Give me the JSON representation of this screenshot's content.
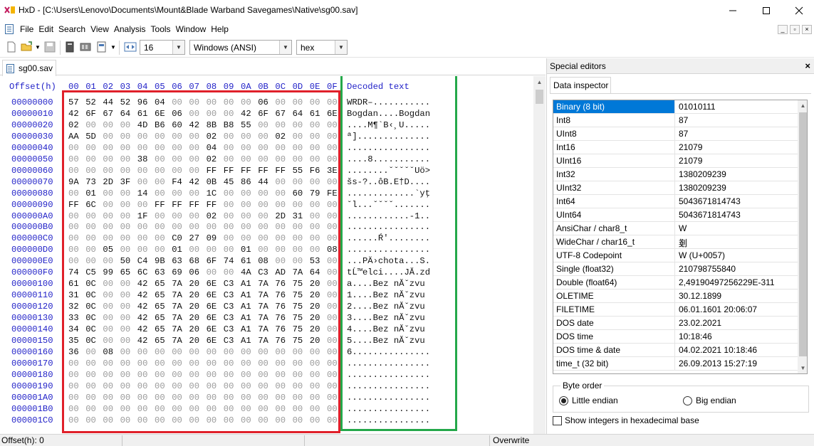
{
  "window": {
    "title": "HxD - [C:\\Users\\Lenovo\\Documents\\Mount&Blade Warband Savegames\\Native\\sg00.sav]"
  },
  "menu": [
    "File",
    "Edit",
    "Search",
    "View",
    "Analysis",
    "Tools",
    "Window",
    "Help"
  ],
  "toolbar": {
    "bytes_per_row": "16",
    "charset": "Windows (ANSI)",
    "offset_base": "hex"
  },
  "document": {
    "tab_label": "sg00.sav"
  },
  "hex": {
    "offset_header": "Offset(h)",
    "columns": [
      "00",
      "01",
      "02",
      "03",
      "04",
      "05",
      "06",
      "07",
      "08",
      "09",
      "0A",
      "0B",
      "0C",
      "0D",
      "0E",
      "0F"
    ],
    "decoded_header": "Decoded text",
    "rows": [
      {
        "offset": "00000000",
        "bytes": [
          "57",
          "52",
          "44",
          "52",
          "96",
          "04",
          "00",
          "00",
          "00",
          "00",
          "00",
          "06",
          "00",
          "00",
          "00",
          "00"
        ],
        "text": "WRDR–..........."
      },
      {
        "offset": "00000010",
        "bytes": [
          "42",
          "6F",
          "67",
          "64",
          "61",
          "6E",
          "06",
          "00",
          "00",
          "00",
          "42",
          "6F",
          "67",
          "64",
          "61",
          "6E"
        ],
        "text": "Bogdan....Bogdan"
      },
      {
        "offset": "00000020",
        "bytes": [
          "02",
          "00",
          "00",
          "00",
          "4D",
          "B6",
          "60",
          "42",
          "8B",
          "B8",
          "55",
          "00",
          "00",
          "00",
          "00",
          "00"
        ],
        "text": "....M¶`B‹¸U....."
      },
      {
        "offset": "00000030",
        "bytes": [
          "AA",
          "5D",
          "00",
          "00",
          "00",
          "00",
          "00",
          "00",
          "02",
          "00",
          "00",
          "00",
          "02",
          "00",
          "00",
          "00"
        ],
        "text": "ª].............."
      },
      {
        "offset": "00000040",
        "bytes": [
          "00",
          "00",
          "00",
          "00",
          "00",
          "00",
          "00",
          "00",
          "04",
          "00",
          "00",
          "00",
          "00",
          "00",
          "00",
          "00"
        ],
        "text": "................"
      },
      {
        "offset": "00000050",
        "bytes": [
          "00",
          "00",
          "00",
          "00",
          "38",
          "00",
          "00",
          "00",
          "02",
          "00",
          "00",
          "00",
          "00",
          "00",
          "00",
          "00"
        ],
        "text": "....8..........."
      },
      {
        "offset": "00000060",
        "bytes": [
          "00",
          "00",
          "00",
          "00",
          "00",
          "00",
          "00",
          "00",
          "FF",
          "FF",
          "FF",
          "FF",
          "FF",
          "55",
          "F6",
          "3E"
        ],
        "text": "........ˇˇˇˇˇUö>"
      },
      {
        "offset": "00000070",
        "bytes": [
          "9A",
          "73",
          "2D",
          "3F",
          "00",
          "00",
          "F4",
          "42",
          "0B",
          "45",
          "86",
          "44",
          "00",
          "00",
          "00",
          "00"
        ],
        "text": "šs-?..ôB.E†D...."
      },
      {
        "offset": "00000080",
        "bytes": [
          "00",
          "01",
          "00",
          "00",
          "14",
          "00",
          "00",
          "00",
          "1C",
          "00",
          "00",
          "00",
          "00",
          "60",
          "79",
          "FE"
        ],
        "text": ".............`yţ"
      },
      {
        "offset": "00000090",
        "bytes": [
          "FF",
          "6C",
          "00",
          "00",
          "00",
          "FF",
          "FF",
          "FF",
          "FF",
          "00",
          "00",
          "00",
          "00",
          "00",
          "00",
          "00"
        ],
        "text": "ˇl...ˇˇˇˇ......."
      },
      {
        "offset": "000000A0",
        "bytes": [
          "00",
          "00",
          "00",
          "00",
          "1F",
          "00",
          "00",
          "00",
          "02",
          "00",
          "00",
          "00",
          "2D",
          "31",
          "00",
          "00"
        ],
        "text": "............-1.."
      },
      {
        "offset": "000000B0",
        "bytes": [
          "00",
          "00",
          "00",
          "00",
          "00",
          "00",
          "00",
          "00",
          "00",
          "00",
          "00",
          "00",
          "00",
          "00",
          "00",
          "00"
        ],
        "text": "................"
      },
      {
        "offset": "000000C0",
        "bytes": [
          "00",
          "00",
          "00",
          "00",
          "00",
          "00",
          "C0",
          "27",
          "09",
          "00",
          "00",
          "00",
          "00",
          "00",
          "00",
          "00"
        ],
        "text": "......Ŕ'........"
      },
      {
        "offset": "000000D0",
        "bytes": [
          "00",
          "00",
          "05",
          "00",
          "00",
          "00",
          "01",
          "00",
          "00",
          "00",
          "01",
          "00",
          "00",
          "00",
          "00",
          "08"
        ],
        "text": "................"
      },
      {
        "offset": "000000E0",
        "bytes": [
          "00",
          "00",
          "00",
          "50",
          "C4",
          "9B",
          "63",
          "68",
          "6F",
          "74",
          "61",
          "08",
          "00",
          "00",
          "53",
          "00"
        ],
        "text": "...PÄ›chota...S."
      },
      {
        "offset": "000000F0",
        "bytes": [
          "74",
          "C5",
          "99",
          "65",
          "6C",
          "63",
          "69",
          "06",
          "00",
          "00",
          "4A",
          "C3",
          "AD",
          "7A",
          "64",
          "00"
        ],
        "text": "tĹ™elci....JĂ.zd"
      },
      {
        "offset": "00000100",
        "bytes": [
          "61",
          "0C",
          "00",
          "00",
          "42",
          "65",
          "7A",
          "20",
          "6E",
          "C3",
          "A1",
          "7A",
          "76",
          "75",
          "20",
          "00"
        ],
        "text": "a....Bez nĂˇzvu "
      },
      {
        "offset": "00000110",
        "bytes": [
          "31",
          "0C",
          "00",
          "00",
          "42",
          "65",
          "7A",
          "20",
          "6E",
          "C3",
          "A1",
          "7A",
          "76",
          "75",
          "20",
          "00"
        ],
        "text": "1....Bez nĂˇzvu "
      },
      {
        "offset": "00000120",
        "bytes": [
          "32",
          "0C",
          "00",
          "00",
          "42",
          "65",
          "7A",
          "20",
          "6E",
          "C3",
          "A1",
          "7A",
          "76",
          "75",
          "20",
          "00"
        ],
        "text": "2....Bez nĂˇzvu "
      },
      {
        "offset": "00000130",
        "bytes": [
          "33",
          "0C",
          "00",
          "00",
          "42",
          "65",
          "7A",
          "20",
          "6E",
          "C3",
          "A1",
          "7A",
          "76",
          "75",
          "20",
          "00"
        ],
        "text": "3....Bez nĂˇzvu "
      },
      {
        "offset": "00000140",
        "bytes": [
          "34",
          "0C",
          "00",
          "00",
          "42",
          "65",
          "7A",
          "20",
          "6E",
          "C3",
          "A1",
          "7A",
          "76",
          "75",
          "20",
          "00"
        ],
        "text": "4....Bez nĂˇzvu "
      },
      {
        "offset": "00000150",
        "bytes": [
          "35",
          "0C",
          "00",
          "00",
          "42",
          "65",
          "7A",
          "20",
          "6E",
          "C3",
          "A1",
          "7A",
          "76",
          "75",
          "20",
          "00"
        ],
        "text": "5....Bez nĂˇzvu "
      },
      {
        "offset": "00000160",
        "bytes": [
          "36",
          "00",
          "08",
          "00",
          "00",
          "00",
          "00",
          "00",
          "00",
          "00",
          "00",
          "00",
          "00",
          "00",
          "00",
          "00"
        ],
        "text": "6..............."
      },
      {
        "offset": "00000170",
        "bytes": [
          "00",
          "00",
          "00",
          "00",
          "00",
          "00",
          "00",
          "00",
          "00",
          "00",
          "00",
          "00",
          "00",
          "00",
          "00",
          "00"
        ],
        "text": "................"
      },
      {
        "offset": "00000180",
        "bytes": [
          "00",
          "00",
          "00",
          "00",
          "00",
          "00",
          "00",
          "00",
          "00",
          "00",
          "00",
          "00",
          "00",
          "00",
          "00",
          "00"
        ],
        "text": "................"
      },
      {
        "offset": "00000190",
        "bytes": [
          "00",
          "00",
          "00",
          "00",
          "00",
          "00",
          "00",
          "00",
          "00",
          "00",
          "00",
          "00",
          "00",
          "00",
          "00",
          "00"
        ],
        "text": "................"
      },
      {
        "offset": "000001A0",
        "bytes": [
          "00",
          "00",
          "00",
          "00",
          "00",
          "00",
          "00",
          "00",
          "00",
          "00",
          "00",
          "00",
          "00",
          "00",
          "00",
          "00"
        ],
        "text": "................"
      },
      {
        "offset": "000001B0",
        "bytes": [
          "00",
          "00",
          "00",
          "00",
          "00",
          "00",
          "00",
          "00",
          "00",
          "00",
          "00",
          "00",
          "00",
          "00",
          "00",
          "00"
        ],
        "text": "................"
      },
      {
        "offset": "000001C0",
        "bytes": [
          "00",
          "00",
          "00",
          "00",
          "00",
          "00",
          "00",
          "00",
          "00",
          "00",
          "00",
          "00",
          "00",
          "00",
          "00",
          "00"
        ],
        "text": "................"
      }
    ]
  },
  "special_editors": {
    "title": "Special editors",
    "tab": "Data inspector",
    "rows": [
      {
        "name": "Binary (8 bit)",
        "value": "01010111"
      },
      {
        "name": "Int8",
        "value": "87"
      },
      {
        "name": "UInt8",
        "value": "87"
      },
      {
        "name": "Int16",
        "value": "21079"
      },
      {
        "name": "UInt16",
        "value": "21079"
      },
      {
        "name": "Int32",
        "value": "1380209239"
      },
      {
        "name": "UInt32",
        "value": "1380209239"
      },
      {
        "name": "Int64",
        "value": "5043671814743"
      },
      {
        "name": "UInt64",
        "value": "5043671814743"
      },
      {
        "name": "AnsiChar / char8_t",
        "value": "W"
      },
      {
        "name": "WideChar / char16_t",
        "value": "剗"
      },
      {
        "name": "UTF-8 Codepoint",
        "value": "W (U+0057)"
      },
      {
        "name": "Single (float32)",
        "value": "210798755840"
      },
      {
        "name": "Double (float64)",
        "value": "2,49190497256229E-311"
      },
      {
        "name": "OLETIME",
        "value": "30.12.1899"
      },
      {
        "name": "FILETIME",
        "value": "06.01.1601 20:06:07"
      },
      {
        "name": "DOS date",
        "value": "23.02.2021"
      },
      {
        "name": "DOS time",
        "value": "10:18:46"
      },
      {
        "name": "DOS time & date",
        "value": "04.02.2021 10:18:46"
      },
      {
        "name": "time_t (32 bit)",
        "value": "26.09.2013 15:27:19"
      }
    ],
    "byte_order": {
      "title": "Byte order",
      "little": "Little endian",
      "big": "Big endian",
      "selected": "little"
    },
    "hex_checkbox": "Show integers in hexadecimal base"
  },
  "status": {
    "offset": "Offset(h): 0",
    "mode": "Overwrite"
  },
  "colors": {
    "offset_blue": "#2222c8",
    "highlight_red": "#e0202a",
    "highlight_green": "#24a84a",
    "selection_blue": "#0078d7"
  }
}
